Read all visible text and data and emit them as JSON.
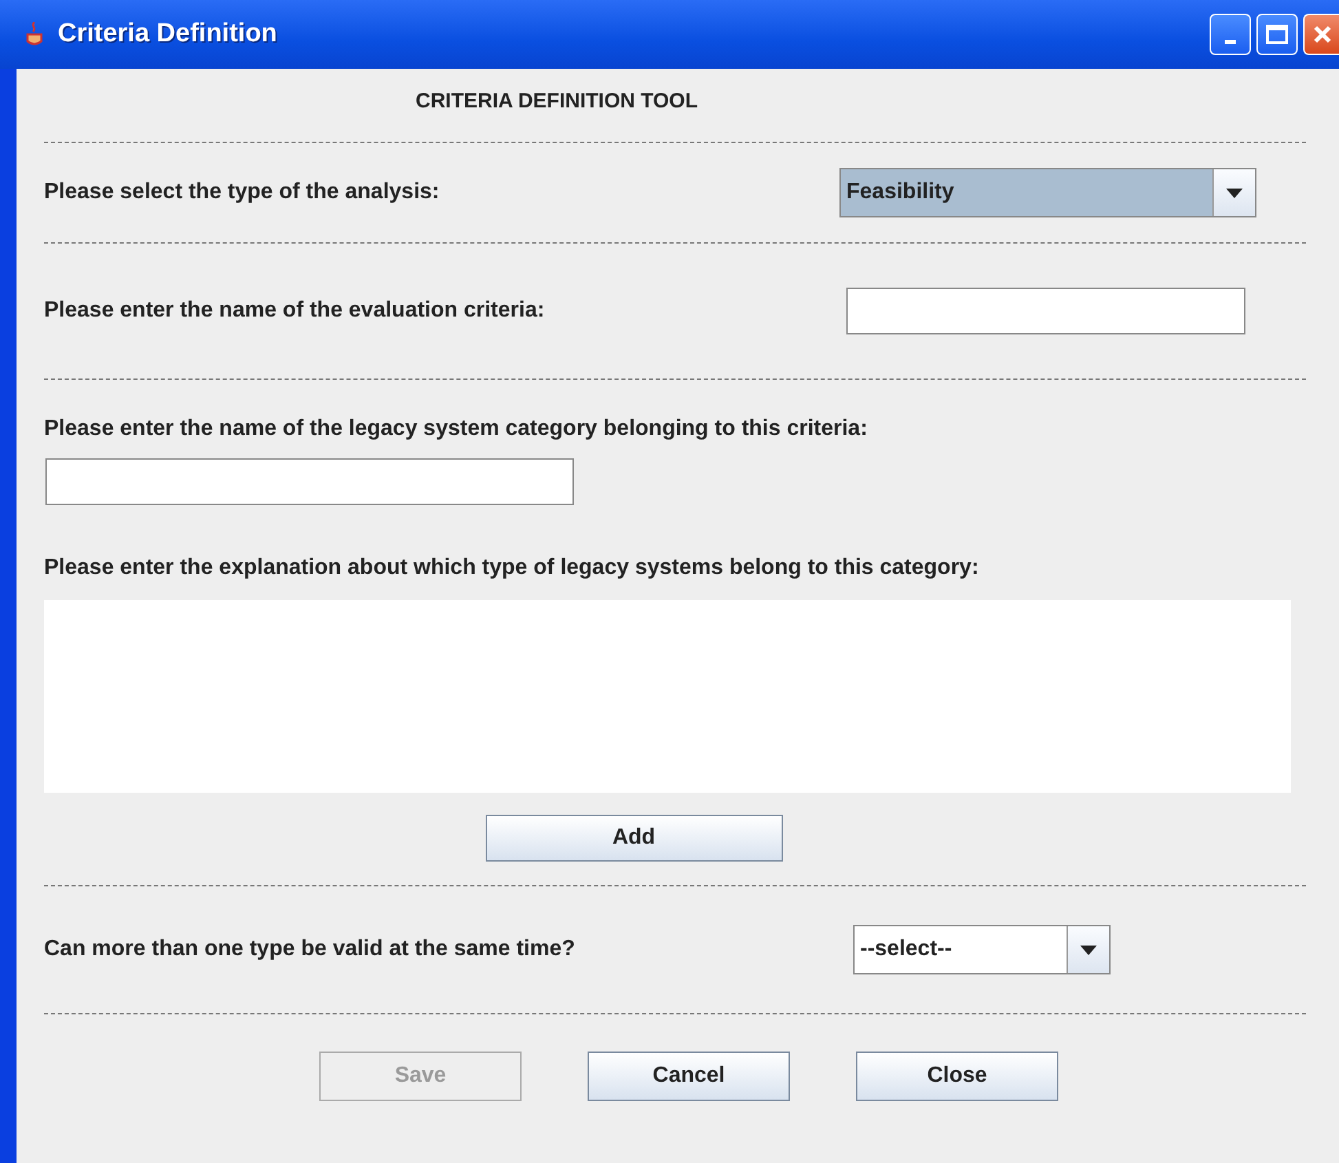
{
  "window": {
    "title": "Criteria Definition"
  },
  "heading": "CRITERIA DEFINITION TOOL",
  "analysis_type": {
    "label": "Please select the type of the analysis:",
    "value": "Feasibility",
    "focused": true
  },
  "criteria_name": {
    "label": "Please enter the name of the evaluation criteria:"
  },
  "category_name": {
    "label": "Please enter the name of the legacy system category belonging to this criteria:"
  },
  "explanation": {
    "label": "Please enter the explanation about which type of legacy systems belong to this category:"
  },
  "add_button": {
    "label": "Add",
    "disabled": false
  },
  "multiple_valid": {
    "label": "Can more than one type be valid at the same time?",
    "value": "--select--",
    "focused": false
  },
  "buttons": [
    {
      "label": "Save",
      "disabled": true
    },
    {
      "label": "Cancel",
      "disabled": false
    },
    {
      "label": "Close",
      "disabled": false
    }
  ]
}
